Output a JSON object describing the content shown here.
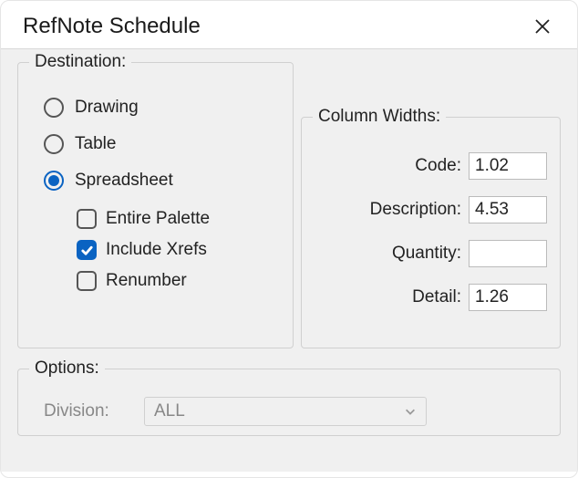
{
  "window": {
    "title": "RefNote Schedule"
  },
  "destination": {
    "legend": "Destination:",
    "radios": [
      {
        "label": "Drawing",
        "checked": false
      },
      {
        "label": "Table",
        "checked": false
      },
      {
        "label": "Spreadsheet",
        "checked": true
      }
    ],
    "checks": [
      {
        "label": "Entire Palette",
        "checked": false
      },
      {
        "label": "Include Xrefs",
        "checked": true
      },
      {
        "label": "Renumber",
        "checked": false
      }
    ]
  },
  "column_widths": {
    "legend": "Column Widths:",
    "fields": {
      "code": {
        "label": "Code:",
        "value": "1.02"
      },
      "description": {
        "label": "Description:",
        "value": "4.53"
      },
      "quantity": {
        "label": "Quantity:",
        "value": ""
      },
      "detail": {
        "label": "Detail:",
        "value": "1.26"
      }
    }
  },
  "options": {
    "legend": "Options:",
    "division": {
      "label": "Division:",
      "value": "ALL"
    }
  }
}
